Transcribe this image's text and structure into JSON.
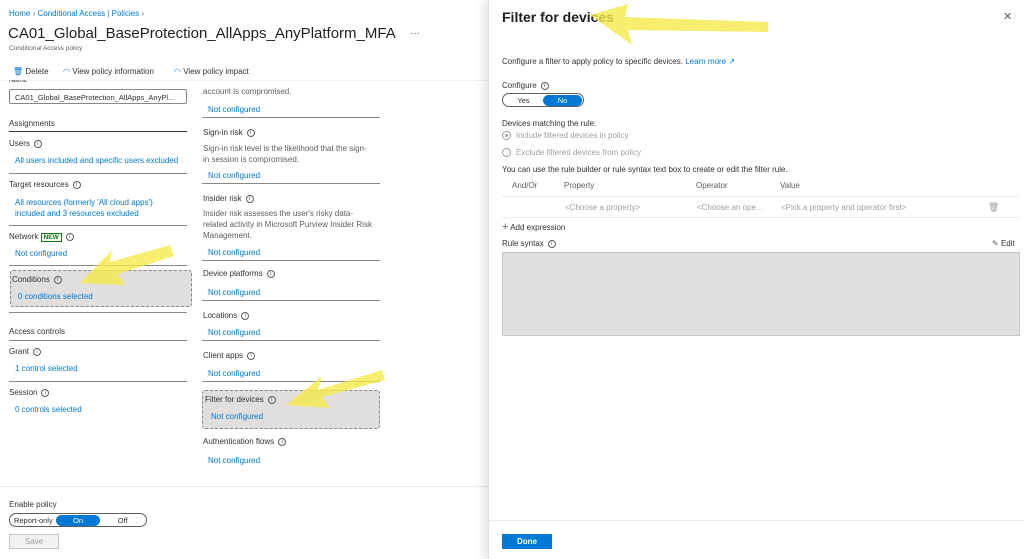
{
  "breadcrumb": [
    "Home",
    "Conditional Access | Policies"
  ],
  "title": "CA01_Global_BaseProtection_AllApps_AnyPlatform_MFA",
  "subtitle": "Conditional Access policy",
  "toolbar": {
    "delete": "Delete",
    "view_info": "View policy information",
    "view_impact": "View policy impact"
  },
  "name": {
    "label": "Name",
    "value": "CA01_Global_BaseProtection_AllApps_AnyPl..."
  },
  "assignments": {
    "heading": "Assignments",
    "users": {
      "label": "Users",
      "value": "All users included and specific users excluded"
    },
    "target": {
      "label": "Target resources",
      "value1": "All resources (formerly 'All cloud apps')",
      "value2": "included and 3 resources excluded"
    },
    "network": {
      "label": "Network",
      "badge": "NEW",
      "value": "Not configured"
    },
    "conditions": {
      "label": "Conditions",
      "value": "0 conditions selected"
    }
  },
  "access": {
    "heading": "Access controls",
    "grant": {
      "label": "Grant",
      "value": "1 control selected"
    },
    "session": {
      "label": "Session",
      "value": "0 controls selected"
    }
  },
  "conditions_list": {
    "user_risk": {
      "desc": "account is compromised.",
      "value": "Not configured"
    },
    "signin_risk": {
      "label": "Sign-in risk",
      "desc1": "Sign-in risk level is the likelihood that the sign-",
      "desc2": "in session is compromised.",
      "value": "Not configured"
    },
    "insider_risk": {
      "label": "Insider risk",
      "desc1": "Insider risk assesses the user's risky data-",
      "desc2": "related activity in Microsoft Purview Insider Risk",
      "desc3": "Management.",
      "value": "Not configured"
    },
    "device_platforms": {
      "label": "Device platforms",
      "value": "Not configured"
    },
    "locations": {
      "label": "Locations",
      "value": "Not configured"
    },
    "client_apps": {
      "label": "Client apps",
      "value": "Not configured"
    },
    "filter_devices": {
      "label": "Filter for devices",
      "value": "Not configured"
    },
    "auth_flows": {
      "label": "Authentication flows",
      "value": "Not configured"
    }
  },
  "enable": {
    "label": "Enable policy",
    "options": [
      "Report-only",
      "On",
      "Off"
    ],
    "selected": "On",
    "save": "Save"
  },
  "panel": {
    "title": "Filter for devices",
    "desc": "Configure a filter to apply policy to specific devices.",
    "learn_more": "Learn more",
    "configure": {
      "label": "Configure",
      "options": [
        "Yes",
        "No"
      ],
      "selected": "No"
    },
    "matching": "Devices matching the rule:",
    "include": "Include filtered devices in policy",
    "exclude": "Exclude filtered devices from policy",
    "hint": "You can use the rule builder or rule syntax text box to create or edit the filter rule.",
    "columns": [
      "And/Or",
      "Property",
      "Operator",
      "Value"
    ],
    "row": {
      "property": "<Choose a property>",
      "operator": "<Choose an ope...",
      "value": "<Pick a property and operator first>"
    },
    "add_expression": "Add expression",
    "rule_syntax": "Rule syntax",
    "edit": "Edit",
    "done": "Done"
  },
  "colors": {
    "accent": "#0078d4",
    "highlight": "#f5e94a"
  }
}
